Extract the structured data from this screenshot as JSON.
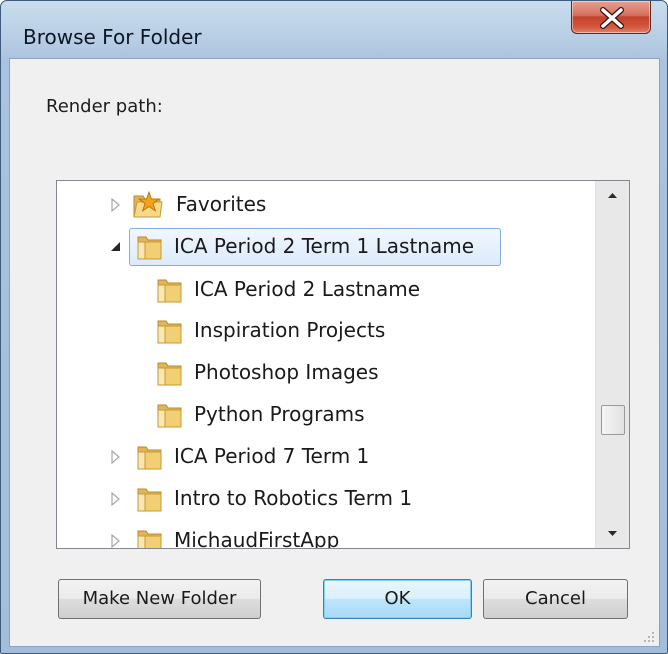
{
  "window": {
    "title": "Browse For Folder",
    "close_glyph": "x"
  },
  "prompt": "Render path:",
  "tree": {
    "items": [
      {
        "label": "Favorites",
        "expander": "collapsed",
        "icon": "favorites-folder-icon",
        "level": 1
      },
      {
        "label": "ICA Period 2 Term 1 Lastname",
        "expander": "expanded",
        "icon": "folder-icon",
        "level": 1,
        "selected": true
      },
      {
        "label": "ICA Period 2 Lastname",
        "expander": "none",
        "icon": "folder-icon",
        "level": 2
      },
      {
        "label": "Inspiration Projects",
        "expander": "none",
        "icon": "folder-icon",
        "level": 2
      },
      {
        "label": "Photoshop Images",
        "expander": "none",
        "icon": "folder-icon",
        "level": 2
      },
      {
        "label": "Python Programs",
        "expander": "none",
        "icon": "folder-icon",
        "level": 2
      },
      {
        "label": "ICA Period 7 Term 1",
        "expander": "collapsed",
        "icon": "folder-icon",
        "level": 1
      },
      {
        "label": "Intro to Robotics Term 1",
        "expander": "collapsed",
        "icon": "folder-icon",
        "level": 1
      },
      {
        "label": "MichaudFirstApp",
        "expander": "collapsed",
        "icon": "folder-icon",
        "level": 1
      }
    ]
  },
  "buttons": {
    "make_new_folder": "Make New Folder",
    "ok": "OK",
    "cancel": "Cancel"
  },
  "colors": {
    "selection_border": "#84acdd",
    "close_red": "#c3432b",
    "default_button_border": "#3c7fb1"
  }
}
